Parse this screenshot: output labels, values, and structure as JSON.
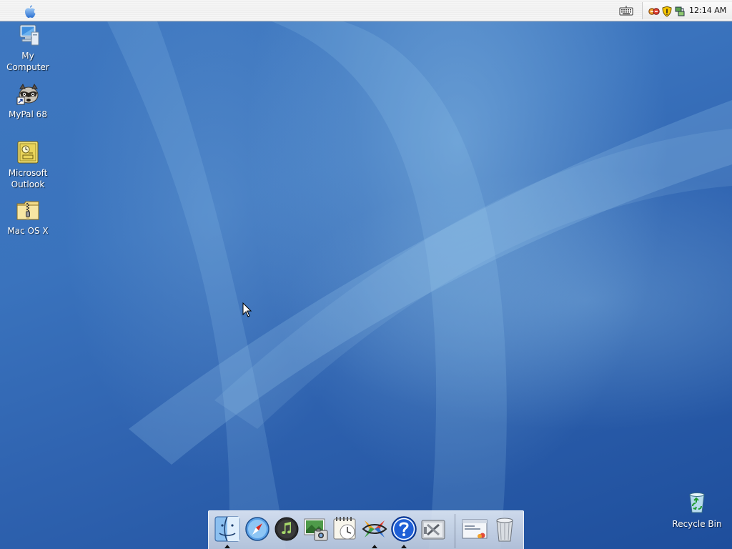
{
  "menubar": {
    "apple_menu_icon": "apple-logo-icon",
    "tray_icons": [
      "keyboard-icon",
      "network-icon",
      "security-shield-icon",
      "connection-icon"
    ],
    "clock": "12:14 AM"
  },
  "desktop": {
    "icons": [
      {
        "id": "my-computer",
        "label_line1": "My",
        "label_line2": "Computer",
        "icon": "computer-icon"
      },
      {
        "id": "mypal",
        "label_line1": "MyPal 68",
        "label_line2": "",
        "icon": "raccoon-icon"
      },
      {
        "id": "outlook",
        "label_line1": "Microsoft",
        "label_line2": "Outlook",
        "icon": "outlook-icon"
      },
      {
        "id": "macosx",
        "label_line1": "Mac OS X",
        "label_line2": "",
        "icon": "zip-folder-icon"
      },
      {
        "id": "recycle-bin",
        "label_line1": "Recycle Bin",
        "label_line2": "",
        "icon": "recycle-bin-icon"
      }
    ]
  },
  "dock": {
    "items": [
      "finder-icon",
      "safari-icon",
      "itunes-icon",
      "iphoto-icon",
      "calendar-icon",
      "pinwheel-icon",
      "help-icon",
      "system-tools-icon",
      "window-icon",
      "trash-icon"
    ],
    "colors": {
      "accent": "#2d6fd6",
      "dock_bg": "#dfe5ef"
    }
  }
}
